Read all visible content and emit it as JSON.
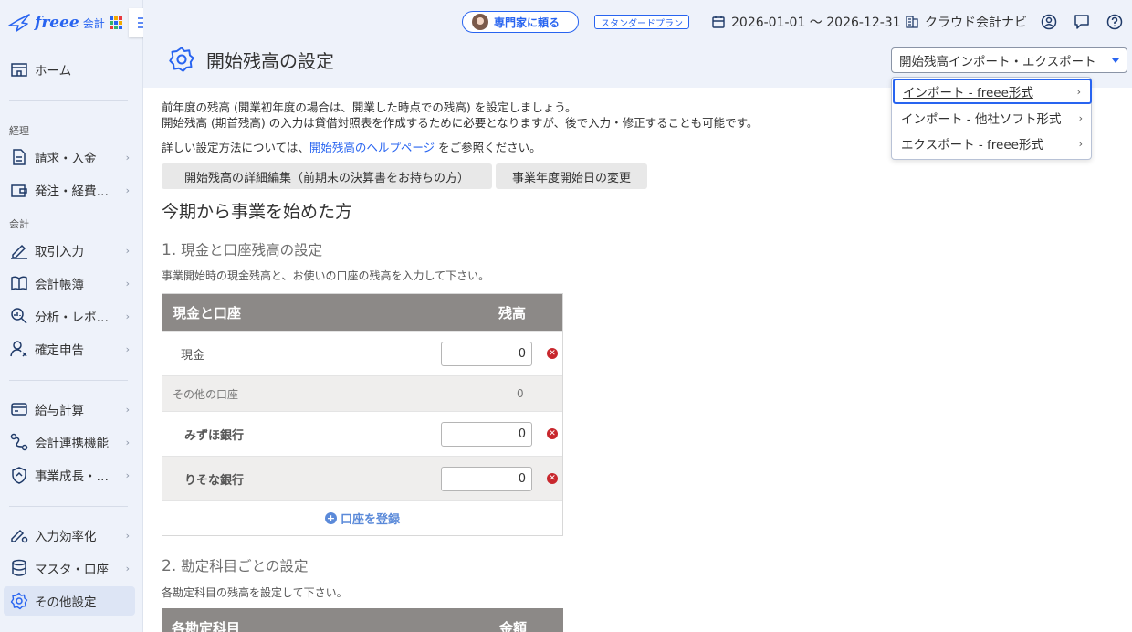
{
  "logo": {
    "brand": "freee",
    "product": "会計",
    "dot_colors": [
      "#2864f0",
      "#f2a900",
      "#e8383d",
      "#33b26b",
      "#2864f0",
      "#f2a900",
      "#e8383d",
      "#33b26b",
      "#2864f0"
    ]
  },
  "sidebar": {
    "sections": {
      "keiri": "経理",
      "kaikei": "会計"
    },
    "items": [
      {
        "label": "ホーム",
        "icon": "home-icon"
      },
      {
        "label": "請求・入金",
        "icon": "document-icon"
      },
      {
        "label": "発注・経費…",
        "icon": "wallet-icon"
      },
      {
        "label": "取引入力",
        "icon": "pen-icon"
      },
      {
        "label": "会計帳簿",
        "icon": "book-icon"
      },
      {
        "label": "分析・レポ…",
        "icon": "analysis-icon"
      },
      {
        "label": "確定申告",
        "icon": "user-tax-icon"
      },
      {
        "label": "給与計算",
        "icon": "card-icon"
      },
      {
        "label": "会計連携機能",
        "icon": "link-icon"
      },
      {
        "label": "事業成長・…",
        "icon": "growth-icon"
      },
      {
        "label": "入力効率化",
        "icon": "pen-gear-icon"
      },
      {
        "label": "マスタ・口座",
        "icon": "database-icon"
      },
      {
        "label": "その他設定",
        "icon": "gear-icon"
      }
    ],
    "active_label": "その他設定"
  },
  "header": {
    "expert_button": "専門家に頼る",
    "plan_badge": "スタンダードプラン",
    "period": "2026-01-01 〜 2026-12-31",
    "navi": "クラウド会計ナビ",
    "page_title": "開始残高の設定",
    "import_export_select": "開始残高インポート・エクスポート"
  },
  "menu": {
    "items": [
      {
        "label": "インポート - freee形式"
      },
      {
        "label": "インポート - 他社ソフト形式"
      },
      {
        "label": "エクスポート - freee形式"
      }
    ]
  },
  "main": {
    "intro_line1": "前年度の残高 (開業初年度の場合は、開業した時点での残高) を設定しましょう。",
    "intro_line2": "開始残高 (期首残高) の入力は貸借対照表を作成するために必要となりますが、後で入力・修正することも可能です。",
    "help_prefix": "詳しい設定方法については、",
    "help_link": "開始残高のヘルプページ",
    "help_suffix": "をご参照ください。",
    "detail_button": "開始残高の詳細編集（前期末の決算書をお持ちの方）",
    "fiscal_button": "事業年度開始日の変更",
    "section_title": "今期から事業を始めた方",
    "step1": {
      "number": "1.",
      "title": "現金と口座残高の設定",
      "desc": "事業開始時の現金残高と、お使いの口座の残高を入力して下さい。"
    },
    "table1": {
      "col_name": "現金と口座",
      "col_balance": "残高",
      "cash": {
        "name": "現金",
        "value": "0"
      },
      "other_accounts": {
        "name": "その他の口座",
        "value": "0"
      },
      "banks": [
        {
          "name": "みずほ銀行",
          "value": "0"
        },
        {
          "name": "りそな銀行",
          "value": "0"
        }
      ],
      "register_link": "口座を登録"
    },
    "step2": {
      "number": "2.",
      "title": "勘定科目ごとの設定",
      "desc": "各勘定科目の残高を設定して下さい。"
    },
    "table2": {
      "col_name": "各勘定科目",
      "col_amount": "金額"
    }
  }
}
